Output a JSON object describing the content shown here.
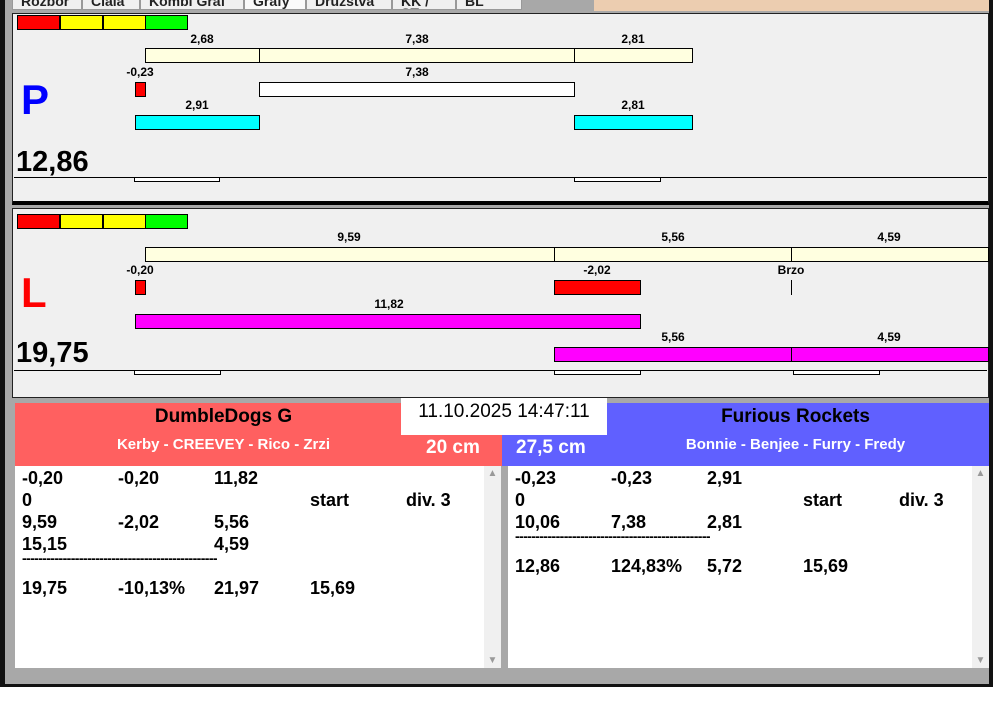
{
  "tabs": [
    "Rozbor",
    "Ciala",
    "Kombi Graf",
    "Grafy",
    "Družstva",
    "KK / ST",
    "BL"
  ],
  "top_panel": {
    "letter": "P",
    "score": "12,86",
    "row1": [
      "2,68",
      "7,38",
      "2,81"
    ],
    "row2": [
      "-0,23",
      "7,38"
    ],
    "row3": [
      "2,91",
      "2,81"
    ]
  },
  "bottom_panel": {
    "letter": "L",
    "score": "19,75",
    "row1": [
      "9,59",
      "5,56",
      "4,59"
    ],
    "row2": [
      "-0,20",
      "-2,02",
      "Brzo"
    ],
    "row3": [
      "11,82"
    ],
    "row4": [
      "5,56",
      "4,59"
    ]
  },
  "datetime": "11.10.2025 14:47:11",
  "colors": {
    "red_team": "#ff6060",
    "blue_team": "#6060ff",
    "p_letter": "#0000ff",
    "l_letter": "#ff0000"
  },
  "left_team": {
    "name": "DumbleDogs G",
    "players": "Kerby - CREEVEY - Rico - Zrzi",
    "distance": "20 cm",
    "rows": [
      [
        "-0,20",
        "-0,20",
        "11,82",
        "",
        ""
      ],
      [
        "0",
        "",
        "",
        "start",
        "div.  3"
      ],
      [
        "9,59",
        "-2,02",
        "5,56",
        "",
        ""
      ],
      [
        "15,15",
        "",
        "4,59",
        "",
        ""
      ]
    ],
    "separator": "------------------------------------------------",
    "total": [
      "19,75",
      "-10,13%",
      "21,97",
      "15,69"
    ]
  },
  "right_team": {
    "name": "Furious Rockets",
    "players": "Bonnie - Benjee - Furry - Fredy",
    "distance": "27,5 cm",
    "rows": [
      [
        "-0,23",
        "-0,23",
        "2,91",
        "",
        ""
      ],
      [
        "0",
        "",
        "",
        "start",
        "div.  3"
      ],
      [
        "10,06",
        "7,38",
        "2,81",
        "",
        ""
      ]
    ],
    "separator": "------------------------------------------------",
    "total": [
      "12,86",
      "124,83%",
      "5,72",
      "15,69"
    ]
  }
}
